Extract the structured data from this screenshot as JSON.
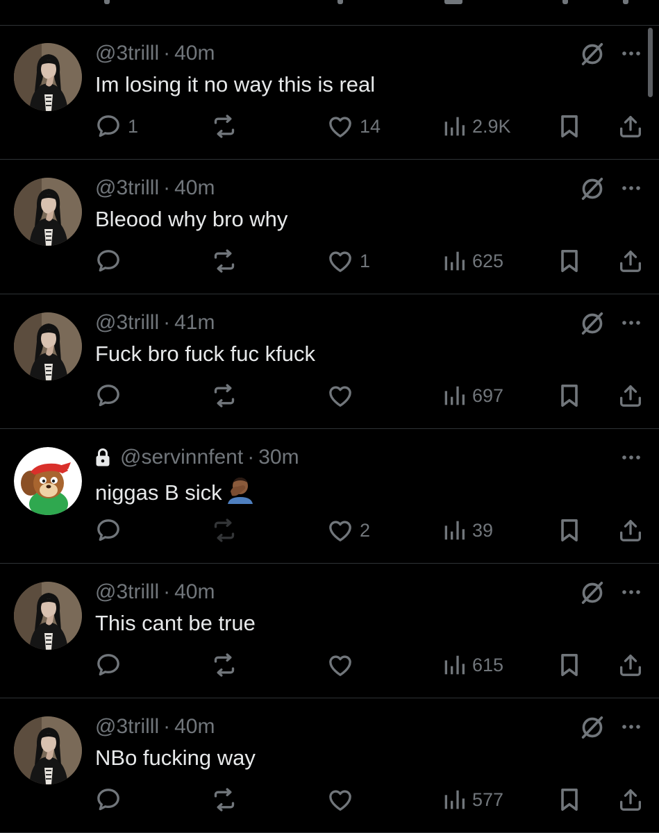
{
  "colors": {
    "background": "#000000",
    "text": "#e7e9ea",
    "muted": "#71767b",
    "divider": "#2f3336"
  },
  "icons": {
    "reply": "speech-bubble-icon",
    "retweet": "retweet-icon",
    "like": "heart-icon",
    "views": "bar-chart-icon",
    "bookmark": "bookmark-icon",
    "share": "share-icon",
    "mute": "mute-icon",
    "more": "more-dots-icon",
    "protected": "lock-icon"
  },
  "posts": [
    {
      "handle": "@3trilll",
      "sep": "·",
      "time": "40m",
      "text": "Im losing it no way this is real",
      "replies": "1",
      "likes": "14",
      "views": "2.9K",
      "avatar": "dark-hair",
      "protected": false,
      "muted": true,
      "emoji": ""
    },
    {
      "handle": "@3trilll",
      "sep": "·",
      "time": "40m",
      "text": "Bleood why bro why",
      "replies": "",
      "likes": "1",
      "views": "625",
      "avatar": "dark-hair",
      "protected": false,
      "muted": true,
      "emoji": ""
    },
    {
      "handle": "@3trilll",
      "sep": "·",
      "time": "41m",
      "text": "Fuck bro fuck fuc kfuck",
      "replies": "",
      "likes": "",
      "views": "697",
      "avatar": "dark-hair",
      "protected": false,
      "muted": true,
      "emoji": ""
    },
    {
      "handle": "@servinnfent",
      "sep": "·",
      "time": "30m",
      "text": "niggas B sick",
      "replies": "",
      "likes": "2",
      "views": "39",
      "avatar": "chipmunk",
      "protected": true,
      "muted": false,
      "emoji": "face-palm"
    },
    {
      "handle": "@3trilll",
      "sep": "·",
      "time": "40m",
      "text": "This cant be true",
      "replies": "",
      "likes": "",
      "views": "615",
      "avatar": "dark-hair",
      "protected": false,
      "muted": true,
      "emoji": ""
    },
    {
      "handle": "@3trilll",
      "sep": "·",
      "time": "40m",
      "text": "NBo fucking way",
      "replies": "",
      "likes": "",
      "views": "577",
      "avatar": "dark-hair",
      "protected": false,
      "muted": true,
      "emoji": ""
    }
  ]
}
